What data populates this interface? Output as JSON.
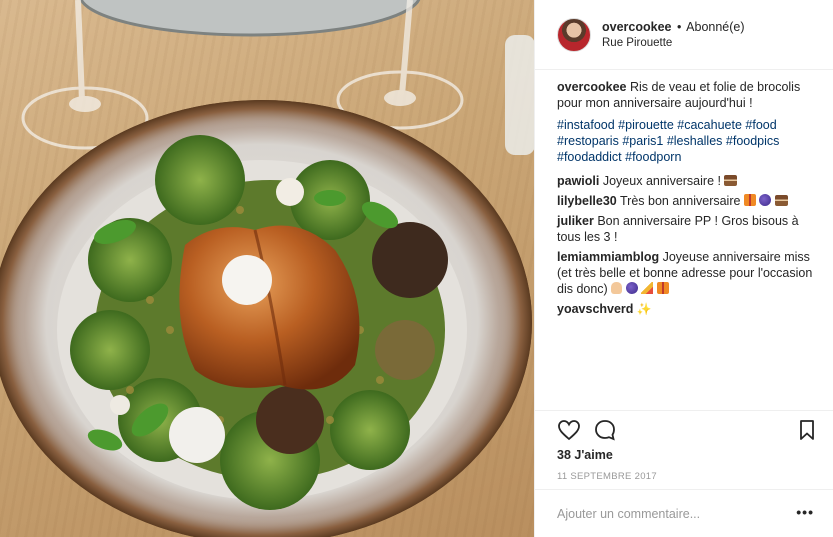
{
  "header": {
    "username": "overcookee",
    "separator": "•",
    "follow_label": "Abonné(e)",
    "location": "Rue Pirouette",
    "avatar_icon": "profile-avatar"
  },
  "caption": {
    "user": "overcookee",
    "text": "Ris de veau et folie de brocolis pour mon anniversaire aujourd'hui !",
    "hashtags": [
      "#instafood",
      "#pirouette",
      "#cacahuete",
      "#food",
      "#restoparis",
      "#paris1",
      "#leshalles",
      "#foodpics",
      "#foodaddict",
      "#foodporn"
    ]
  },
  "comments": [
    {
      "user": "pawioli",
      "text": "Joyeux anniversaire !",
      "emojis": [
        "cake"
      ]
    },
    {
      "user": "lilybelle30",
      "text": "Très bon anniversaire",
      "emojis": [
        "gift",
        "balloon",
        "cake"
      ]
    },
    {
      "user": "juliker",
      "text": "Bon anniversaire PP ! Gros bisous à tous les 3 !",
      "emojis": []
    },
    {
      "user": "lemiammiamblog",
      "text": "Joyeuse anniversaire miss (et très belle et bonne adresse pour l'occasion dis donc)",
      "emojis": [
        "hand",
        "balloon",
        "party",
        "gift"
      ]
    },
    {
      "user": "yoavschverd",
      "text": "",
      "emojis": [
        "sparkles"
      ]
    }
  ],
  "actions": {
    "like_icon": "heart-outline",
    "comment_icon": "speech-bubble",
    "save_icon": "bookmark",
    "likes_text": "38 J'aime",
    "date": "11 septembre 2017"
  },
  "add_comment": {
    "placeholder": "Ajouter un commentaire...",
    "more_label": "•••"
  },
  "colors": {
    "hashtag": "#003569",
    "text": "#262626",
    "muted": "#999999",
    "border": "#efefef"
  }
}
